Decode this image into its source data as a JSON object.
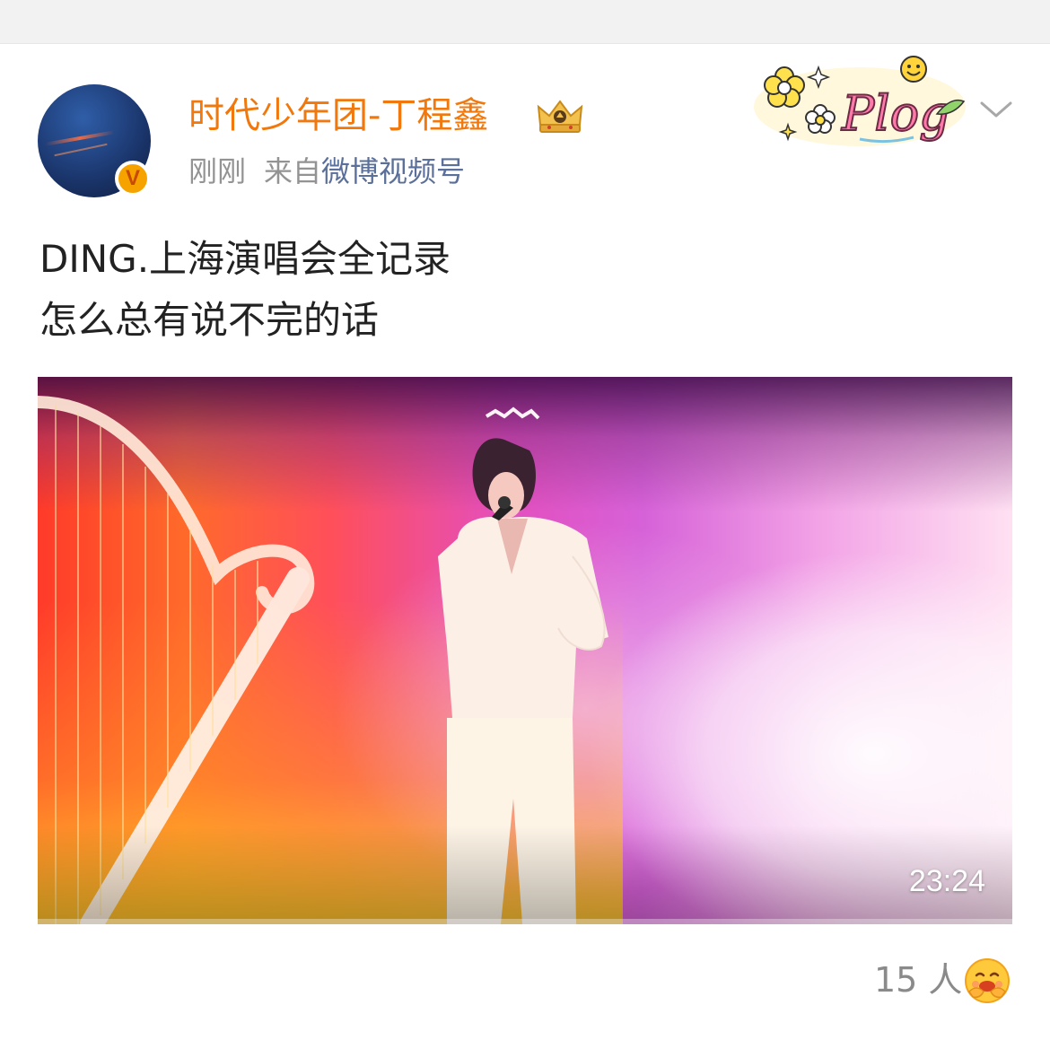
{
  "post": {
    "username": "时代少年团-丁程鑫",
    "time": "刚刚",
    "source_prefix": "来自",
    "source_name": "微博视频号",
    "text_line1": "DING.上海演唱会全记录",
    "text_line2": "怎么总有说不完的话",
    "verified_badge": "V"
  },
  "video": {
    "duration": "23:24"
  },
  "reactions": {
    "count_label": "15 人"
  },
  "icons": {
    "badge": "crown-icon",
    "menu": "chevron-down-icon",
    "reaction": "hug-emoji-icon",
    "sticker": "plog-sticker"
  },
  "colors": {
    "username": "#f0780c",
    "link": "#5a6f99",
    "meta": "#939393",
    "verified": "#f6a300"
  }
}
